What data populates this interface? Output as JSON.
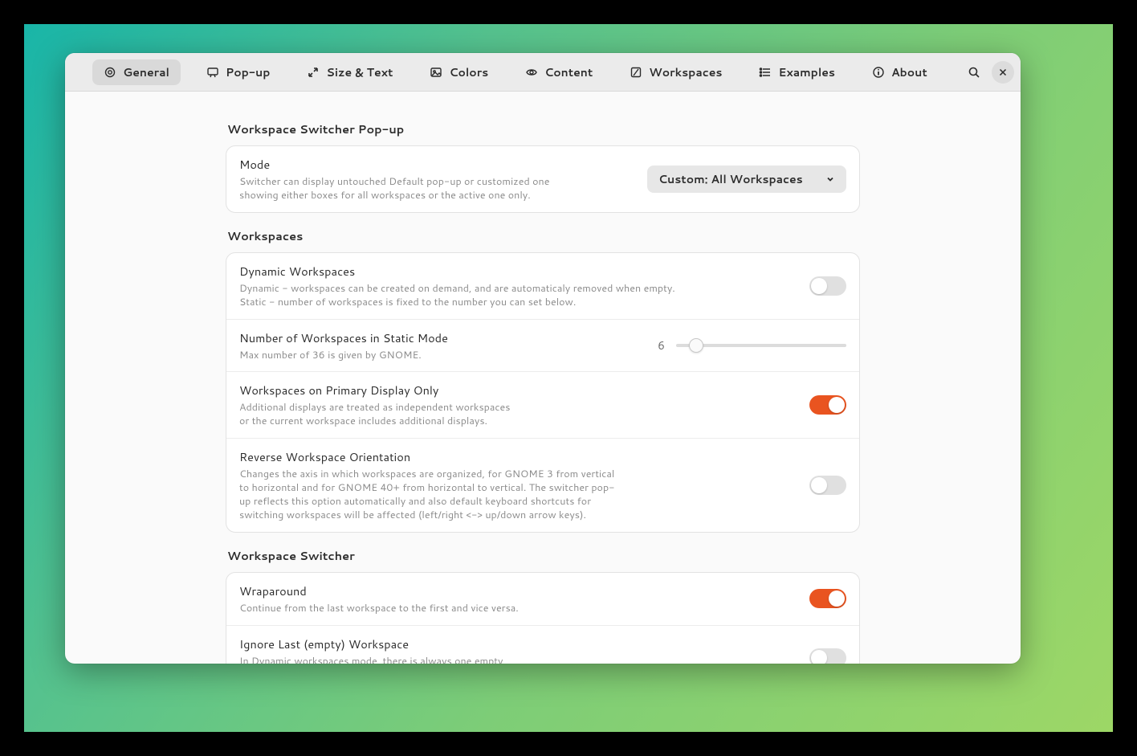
{
  "tabs": [
    {
      "label": "General",
      "icon": "gear"
    },
    {
      "label": "Pop-up",
      "icon": "popup"
    },
    {
      "label": "Size & Text",
      "icon": "expand"
    },
    {
      "label": "Colors",
      "icon": "image"
    },
    {
      "label": "Content",
      "icon": "eye"
    },
    {
      "label": "Workspaces",
      "icon": "workspaces"
    },
    {
      "label": "Examples",
      "icon": "list"
    },
    {
      "label": "About",
      "icon": "info"
    }
  ],
  "active_tab": 0,
  "sections": {
    "popup": {
      "heading": "Workspace Switcher Pop-up",
      "mode": {
        "title": "Mode",
        "desc": "Switcher can display untouched Default pop-up or customized one\nshowing either boxes for all workspaces or the active one only.",
        "value": "Custom: All Workspaces"
      }
    },
    "workspaces": {
      "heading": "Workspaces",
      "dynamic": {
        "title": "Dynamic Workspaces",
        "desc": "Dynamic - workspaces can be created on demand, and are automaticaly removed when empty.\nStatic - number of workspaces is fixed to the number you can set below.",
        "on": false
      },
      "number": {
        "title": "Number of Workspaces in Static Mode",
        "desc": "Max number of 36 is given by GNOME.",
        "value": 6,
        "min": 2,
        "max": 36
      },
      "primary": {
        "title": "Workspaces on Primary Display Only",
        "desc": "Additional displays are treated as independent workspaces\nor the current workspace includes additional displays.",
        "on": true
      },
      "reverse": {
        "title": "Reverse Workspace Orientation",
        "desc": "Changes the axis in which workspaces are organized, for GNOME 3 from vertical\nto horizontal and for GNOME 40+ from horizontal to vertical. The switcher pop-\nup reflects this option automatically and also default keyboard shortcuts for\nswitching workspaces will be affected (left/right <-> up/down arrow keys).",
        "on": false
      }
    },
    "switcher": {
      "heading": "Workspace Switcher",
      "wrap": {
        "title": "Wraparound",
        "desc": "Continue from the last workspace to the first and vice versa.",
        "on": true
      },
      "ignore": {
        "title": "Ignore Last (empty) Workspace",
        "desc": "In Dynamic workspaces mode, there is always one empty\nworkspace at the end. Switcher can ignore this last workspace.",
        "on": false
      }
    }
  },
  "colors": {
    "accent": "#e95420"
  }
}
